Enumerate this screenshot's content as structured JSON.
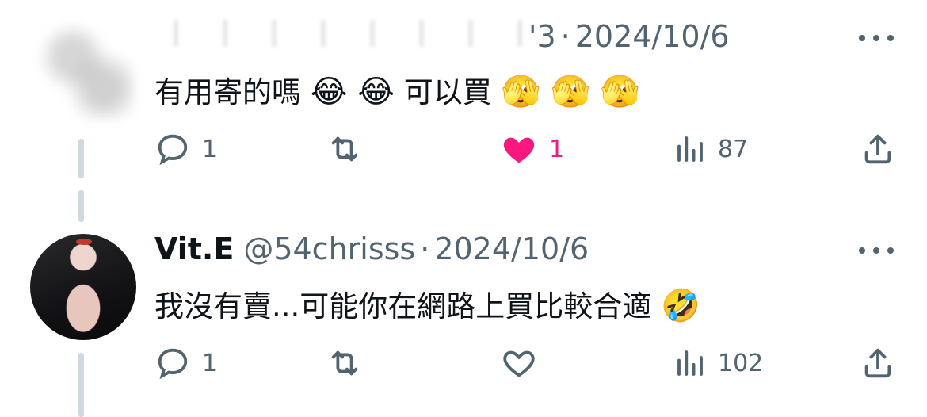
{
  "tweets": [
    {
      "author_partial": "'3",
      "separator": "·",
      "date": "2024/10/6",
      "text": "有用寄的嗎",
      "emoji_group1": "😂 😂",
      "text2": "可以買",
      "emoji_group2": "🫣 🫣 🫣",
      "replies": "1",
      "likes": "1",
      "liked": true,
      "views": "87"
    },
    {
      "name": "Vit.E",
      "handle": "@54chrisss",
      "separator": "·",
      "date": "2024/10/6",
      "text": "我沒有賣...可能你在網路上買比較合適",
      "emoji": "🤣",
      "replies": "1",
      "likes": "",
      "liked": false,
      "views": "102"
    }
  ],
  "colors": {
    "muted": "#536471",
    "text": "#0f1419",
    "like_active": "#f91880",
    "thread_line": "#cfd9de"
  },
  "icons": [
    "more-icon",
    "reply-icon",
    "retweet-icon",
    "like-icon",
    "views-icon",
    "share-icon"
  ]
}
